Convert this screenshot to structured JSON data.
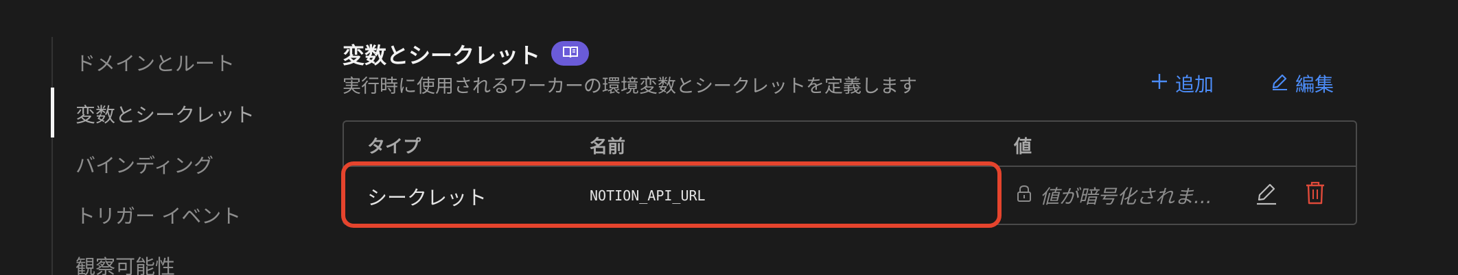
{
  "sidebar": {
    "items": [
      {
        "label": "ドメインとルート"
      },
      {
        "label": "変数とシークレット",
        "active": true
      },
      {
        "label": "バインディング"
      },
      {
        "label": "トリガー イベント"
      },
      {
        "label": "観察可能性"
      }
    ]
  },
  "section": {
    "title": "変数とシークレット",
    "subtitle": "実行時に使用されるワーカーの環境変数とシークレットを定義します",
    "docs_icon": "book-icon",
    "actions": {
      "add_label": "追加",
      "add_icon": "plus-icon",
      "edit_label": "編集",
      "edit_icon": "pencil-icon"
    }
  },
  "table": {
    "columns": [
      "タイプ",
      "名前",
      "値"
    ],
    "rows": [
      {
        "type": "シークレット",
        "name": "NOTION_API_URL",
        "value": "値が暗号化されま...",
        "value_icon": "lock-icon",
        "edit_icon": "pencil-icon",
        "delete_icon": "trash-icon"
      }
    ]
  },
  "colors": {
    "background": "#1b1b1b",
    "accent_link": "#4c8cf7",
    "badge": "#6a5bd8",
    "highlight": "#e5442d",
    "delete": "#e04a3a"
  }
}
